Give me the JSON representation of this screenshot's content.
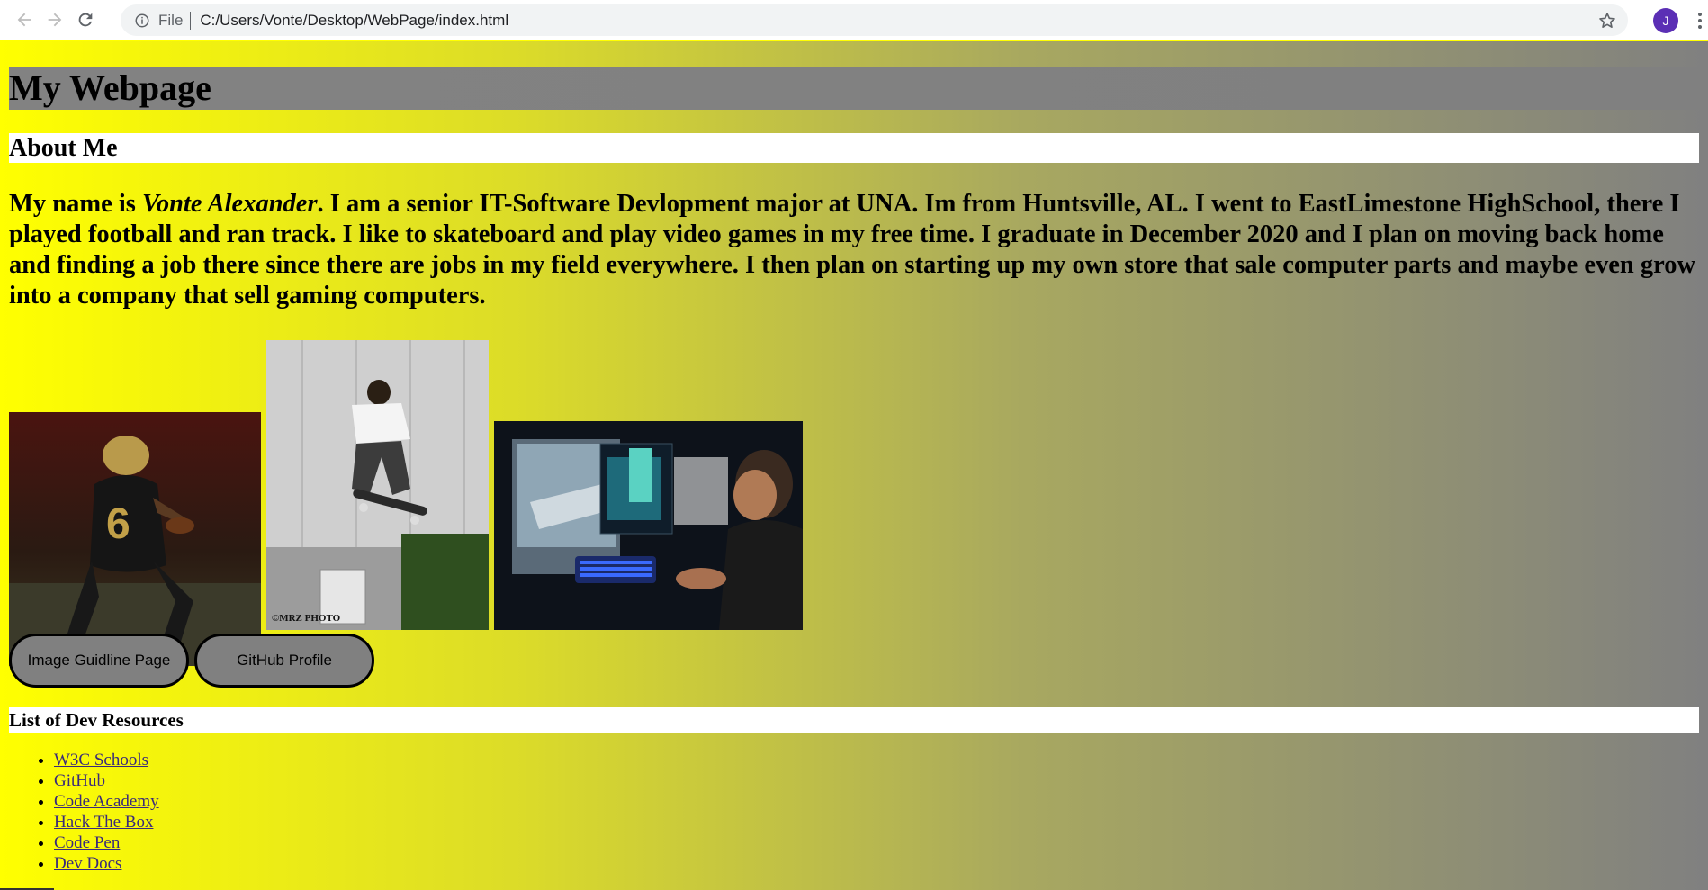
{
  "browser": {
    "url_scheme": "File",
    "url": "C:/Users/Vonte/Desktop/WebPage/index.html",
    "avatar_initial": "J"
  },
  "page": {
    "title": "My Webpage",
    "about_heading": "About Me",
    "bio": {
      "prefix": "My name is ",
      "name": "Vonte Alexander",
      "rest": ". I am a senior IT-Software Devlopment major at UNA. Im from Huntsville, AL. I went to EastLimestone HighSchool, there I played football and ran track. I like to skateboard and play video games in my free time. I graduate in December 2020 and I plan on moving back home and finding a job there since there are jobs in my field everywhere. I then plan on starting up my own store that sale computer parts and maybe even grow into a company that sell gaming computers."
    },
    "buttons": {
      "image_guideline": "Image Guidline Page",
      "github_profile": "GitHub Profile"
    },
    "resources_heading": "List of Dev Resources",
    "resources": [
      "W3C Schools",
      "GitHub",
      "Code Academy",
      "Hack The Box",
      "Code Pen",
      "Dev Docs"
    ],
    "photo_caption": "©MRZ PHOTO"
  },
  "colors": {
    "gradient_start": "#ffff00",
    "gradient_end": "#808080",
    "button_fill": "#808080"
  }
}
